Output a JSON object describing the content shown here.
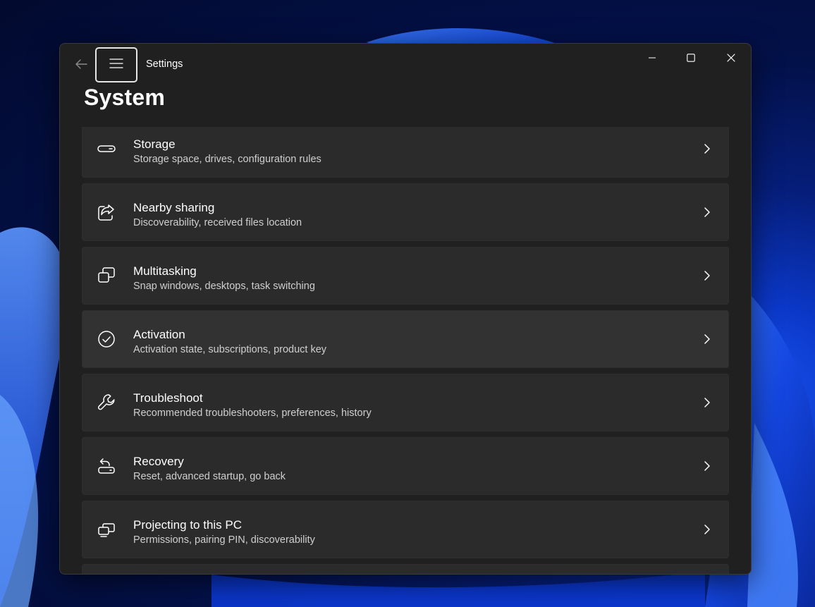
{
  "window": {
    "app_title": "Settings",
    "page_title": "System",
    "background_color": "#202020",
    "card_color": "#2b2b2b"
  },
  "titlebar": {
    "back_icon": "arrow-left-icon",
    "menu_icon": "hamburger-menu-icon",
    "minimize_icon": "minimize-icon",
    "maximize_icon": "maximize-icon",
    "close_icon": "close-icon"
  },
  "settings_items": [
    {
      "title": "Storage",
      "description": "Storage space, drives, configuration rules",
      "icon": "storage-drive-icon"
    },
    {
      "title": "Nearby sharing",
      "description": "Discoverability, received files location",
      "icon": "share-icon"
    },
    {
      "title": "Multitasking",
      "description": "Snap windows, desktops, task switching",
      "icon": "multitasking-icon"
    },
    {
      "title": "Activation",
      "description": "Activation state, subscriptions, product key",
      "icon": "checkmark-circle-icon"
    },
    {
      "title": "Troubleshoot",
      "description": "Recommended troubleshooters, preferences, history",
      "icon": "wrench-icon"
    },
    {
      "title": "Recovery",
      "description": "Reset, advanced startup, go back",
      "icon": "recovery-icon"
    },
    {
      "title": "Projecting to this PC",
      "description": "Permissions, pairing PIN, discoverability",
      "icon": "projecting-icon"
    }
  ]
}
